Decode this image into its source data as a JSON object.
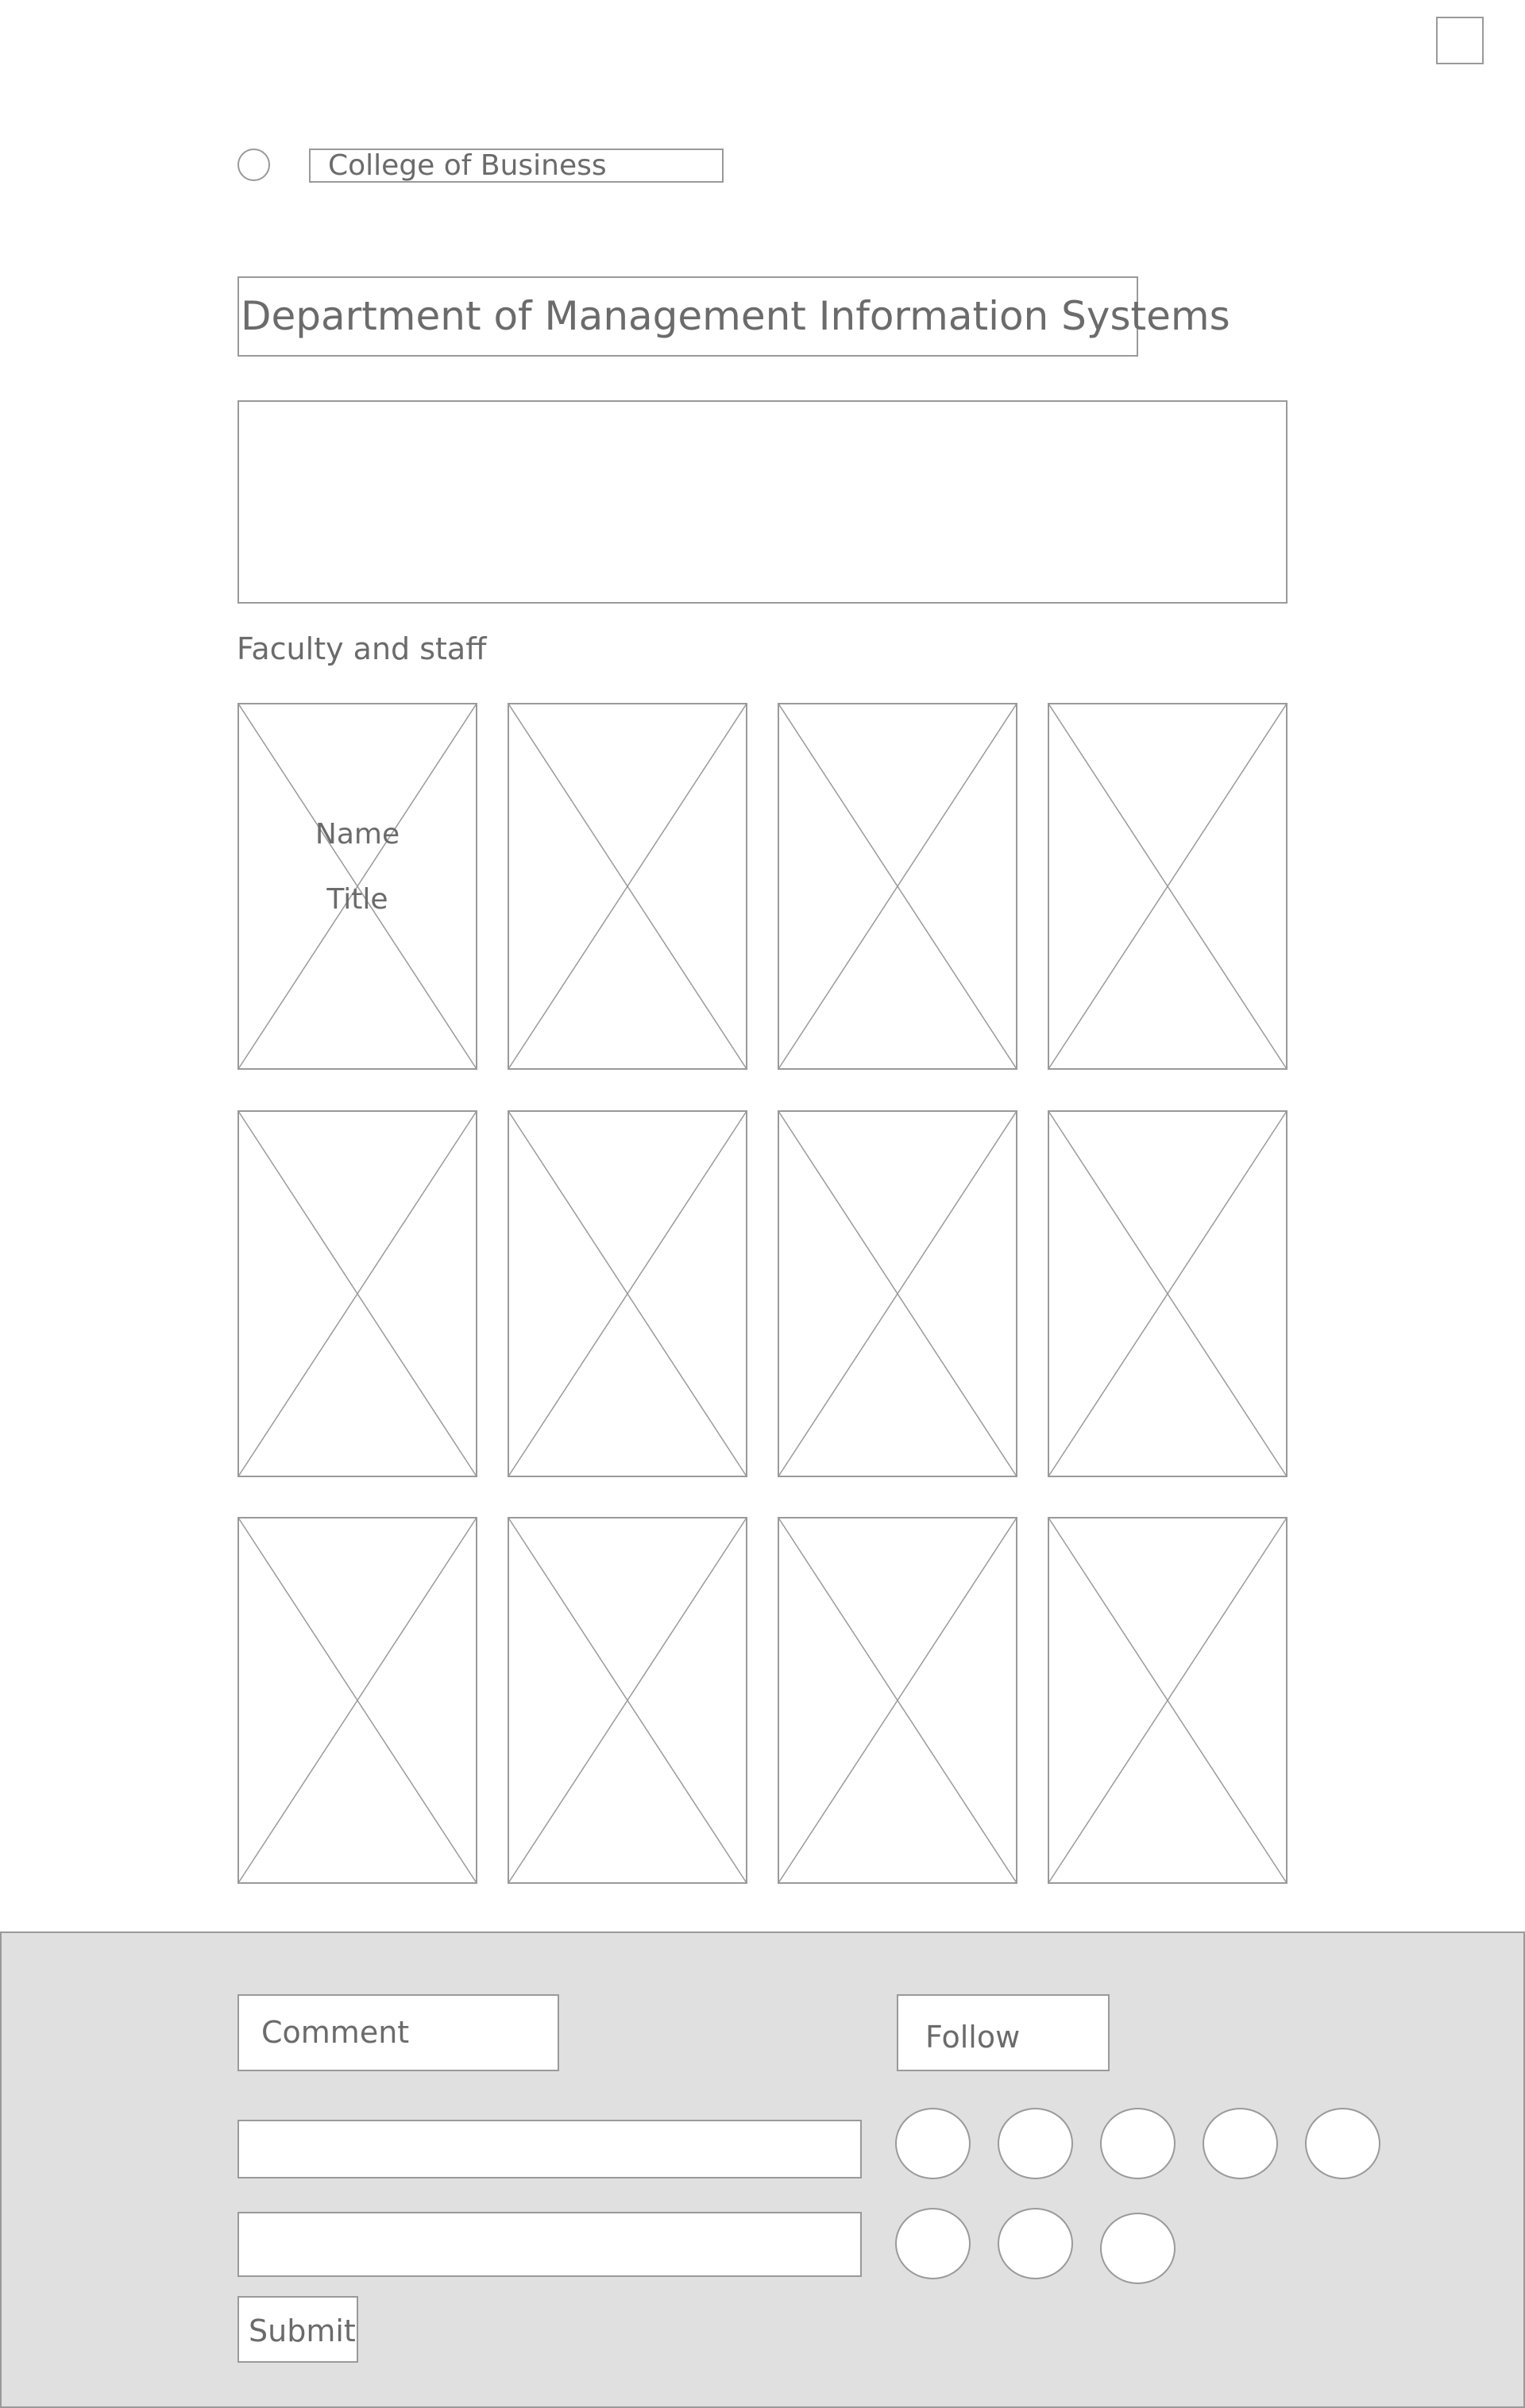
{
  "header": {
    "college_label": "College of Business",
    "department_title": "Department of Management Information Systems"
  },
  "section": {
    "label": "Faculty and staff"
  },
  "faculty_cards": [
    {
      "name": "Name",
      "title": "Title"
    },
    {},
    {},
    {},
    {},
    {},
    {},
    {},
    {},
    {},
    {},
    {}
  ],
  "footer": {
    "comment_label": "Comment",
    "follow_label": "Follow",
    "submit_label": "Submit",
    "social_icons": [
      "social-icon-1",
      "social-icon-2",
      "social-icon-3",
      "social-icon-4",
      "social-icon-5",
      "social-icon-6",
      "social-icon-7",
      "social-icon-8"
    ]
  },
  "colors": {
    "stroke": "#9a9a9a",
    "text": "#6b6b6b",
    "footer_bg": "#e0e0e0",
    "page_bg": "#ffffff"
  }
}
